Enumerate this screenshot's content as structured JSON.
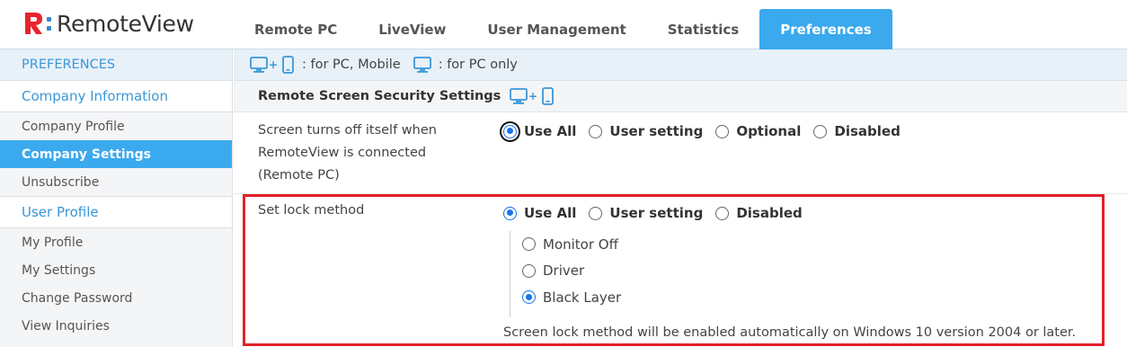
{
  "app": {
    "name": "RemoteView",
    "logo_icon": "remoteview-logo-icon",
    "accent_color": "#3ba9ee",
    "brand_red": "#e8232c"
  },
  "nav": {
    "tabs": [
      {
        "label": "Remote PC",
        "active": false
      },
      {
        "label": "LiveView",
        "active": false
      },
      {
        "label": "User Management",
        "active": false
      },
      {
        "label": "Statistics",
        "active": false
      },
      {
        "label": "Preferences",
        "active": true
      }
    ]
  },
  "sidebar": {
    "header": "PREFERENCES",
    "sections": [
      {
        "title": "Company Information",
        "items": [
          {
            "label": "Company Profile",
            "active": false
          },
          {
            "label": "Company Settings",
            "active": true
          },
          {
            "label": "Unsubscribe",
            "active": false
          }
        ]
      },
      {
        "title": "User Profile",
        "items": [
          {
            "label": "My Profile",
            "active": false
          },
          {
            "label": "My Settings",
            "active": false
          },
          {
            "label": "Change Password",
            "active": false
          },
          {
            "label": "View Inquiries",
            "active": false
          }
        ]
      }
    ]
  },
  "legend": {
    "pc_mobile_text": ": for PC, Mobile",
    "pc_only_text": ": for PC only",
    "pc_mobile_icon": "pc-mobile-icon",
    "pc_only_icon": "pc-icon"
  },
  "section": {
    "title": "Remote Screen Security Settings",
    "icon": "pc-mobile-icon"
  },
  "screen_off": {
    "label_lines": [
      "Screen turns off itself when",
      "RemoteView is connected",
      "(Remote PC)"
    ],
    "options": [
      {
        "label": "Use All",
        "selected": true,
        "focused": true
      },
      {
        "label": "User setting",
        "selected": false
      },
      {
        "label": "Optional",
        "selected": false
      },
      {
        "label": "Disabled",
        "selected": false
      }
    ]
  },
  "lock_method": {
    "label": "Set lock method",
    "options": [
      {
        "label": "Use All",
        "selected": true
      },
      {
        "label": "User setting",
        "selected": false
      },
      {
        "label": "Disabled",
        "selected": false
      }
    ],
    "sub_options": [
      {
        "label": "Monitor Off",
        "selected": false
      },
      {
        "label": "Driver",
        "selected": false
      },
      {
        "label": "Black Layer",
        "selected": true
      }
    ],
    "note": "Screen lock method will be enabled automatically on Windows 10 version 2004 or later.",
    "highlight_color": "#e3202a"
  }
}
